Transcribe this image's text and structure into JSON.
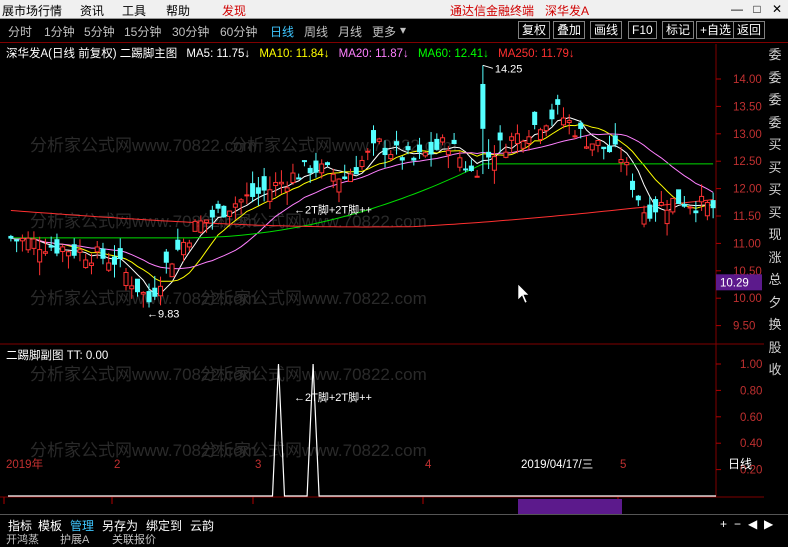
{
  "menubar": {
    "items": [
      "展市场行情",
      "资讯",
      "工具",
      "帮助",
      "发现",
      "通达信金融终端",
      "深华发A"
    ]
  },
  "toolbar": {
    "periods": [
      "分时",
      "1分钟",
      "5分钟",
      "15分钟",
      "30分钟",
      "60分钟",
      "日线",
      "周线",
      "月线",
      "更多"
    ],
    "active_period": "日线",
    "buttons": [
      "复权",
      "叠加",
      "画线",
      "F10",
      "标记",
      "+自选",
      "返回"
    ]
  },
  "main_title": {
    "name": "深华发A(日线 前复权) 二踢脚主图",
    "ma": [
      {
        "label": "MA5: 11.75",
        "color": "#ffffff"
      },
      {
        "label": "MA10: 11.84",
        "color": "#ffff00"
      },
      {
        "label": "MA20: 11.87",
        "color": "#ff80ff"
      },
      {
        "label": "MA60: 12.41",
        "color": "#00ff00"
      },
      {
        "label": "MA250: 11.79",
        "color": "#ff3030"
      }
    ]
  },
  "sub_title": "二踢脚副图  TT: 0.00",
  "price_axis": [
    "14.00",
    "13.50",
    "13.00",
    "12.50",
    "12.00",
    "11.50",
    "11.00",
    "10.50",
    "10.00",
    "9.50"
  ],
  "current_price_label": "10.29",
  "sub_axis": [
    "1.00",
    "0.80",
    "0.60",
    "0.40",
    "0.20"
  ],
  "annotations": {
    "high": "14.25",
    "low": "9.83",
    "signal_main": "←2T脚+2T脚++",
    "signal_sub": "←2T脚+2T脚++"
  },
  "date_axis": {
    "labels": [
      "2019年",
      "2",
      "3",
      "4",
      "5"
    ],
    "cursor_date": "2019/04/17/三",
    "period_label": "日线"
  },
  "watermark": "分析家公式网www.70822.com",
  "bottom_tabs": [
    "指标",
    "模板",
    "管理",
    "另存为",
    "绑定到",
    "云韵"
  ],
  "bottom_active": "管理",
  "status_items": [
    "开鸿蒸",
    "护展A",
    "关联报价"
  ],
  "right_panel_chars": [
    "委",
    "委",
    "委",
    "委",
    "买",
    "买",
    "买",
    "买",
    "现",
    "涨",
    "总",
    "夕",
    "换",
    "股",
    "收"
  ]
}
